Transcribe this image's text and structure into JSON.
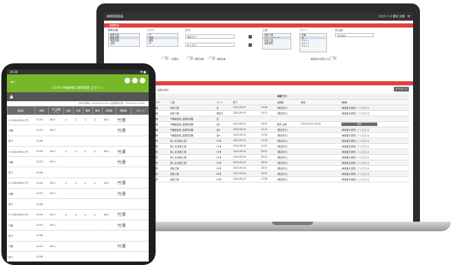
{
  "laptop": {
    "app_title": "帳票管理画面",
    "user_info": "(ログイン) 帯谷 太郎",
    "menu_label": "≡",
    "search_bar": "実績検索",
    "filters": {
      "factory_label": "帳票分類：",
      "factory_options": [
        "帳票分類",
        "製造日報",
        "検査記録",
        "点検"
      ],
      "floor_label": "フロア：",
      "floor_options": [
        "1F",
        "竹輪",
        "揚物",
        "2F"
      ],
      "date_label": "日付：",
      "date_start": "開始日付：",
      "date_end": "終了日付：",
      "process_label": "工程：",
      "process_options": [
        "技術工程",
        "ストックヤード",
        "加熱工程",
        "金属検知"
      ],
      "line_label": "ライン：",
      "line_options": [
        "竹輪",
        "全",
        "1ライン",
        "2ライン",
        "3ライン"
      ],
      "person_label": "担当者：",
      "person_placeholder": "担当者名",
      "toggle1": "一覧表示",
      "toggle2": "異状対策",
      "toggle3": "承認対象",
      "toggle4": "承認済みを表示する"
    },
    "legend": {
      "a": "●コメントあり",
      "b": "●一覧表示",
      "c": "●一覧表示済み"
    },
    "reload": "↻ リロード",
    "table": {
      "group_headers": [
        "記録",
        "承認フロー"
      ],
      "columns": [
        "開始",
        "",
        "フロア",
        "工程",
        "ライン",
        "終了",
        "",
        "記録者",
        "承認",
        "(管理)"
      ],
      "rows": [
        [
          "2024-09-25",
          "10:27",
          "竹輪",
          "技術工程",
          "全",
          "2024-09-25",
          "10:28",
          "(署名待ち)",
          "",
          "(承認者を選択してください)"
        ],
        [
          "2024-09-25",
          "10:21",
          "竹輪",
          "技術工程",
          "測定日",
          "2024-09-25",
          "10:21",
          "(署名待ち)",
          "",
          "(承認者を選択してください)"
        ],
        [
          "2024-09-24",
          "16:55",
          "竹輪",
          "竹輪製品用_金属探知機",
          "全",
          "",
          "",
          "",
          "",
          ""
        ],
        [
          "2024-09-24",
          "16:49",
          "竹輪",
          "竹輪製品用_金属探知機",
          "全A",
          "2024-09-24",
          "16:53",
          "藤本 太郎",
          "2024-09-24 16:54",
          "承認"
        ],
        [
          "2024-09-24",
          "13:13",
          "竹輪",
          "竹輪製品用_金属探知機",
          "全A",
          "2024-09-24",
          "13:14",
          "(署名待ち)",
          "",
          "(承認者を選択してください)"
        ],
        [
          "2024-09-24",
          "11:52",
          "竹輪",
          "竹輪製品用_金属探知機",
          "全A",
          "2024-09-24",
          "11:54",
          "(署名待ち)",
          "",
          "(承認者を選択してください)"
        ],
        [
          "2024-09-24",
          "21:32",
          "揚物",
          "揚し油 技術工程",
          "01号",
          "2024-09-24",
          "21:34",
          "(署名待ち)",
          "",
          "(承認者を選択してください)"
        ],
        [
          "2024-09-24",
          "21:02",
          "揚物",
          "揚し油 技術工程",
          "01号",
          "2024-09-24",
          "21:03",
          "(署名待ち)",
          "",
          "(承認者を選択してください)"
        ],
        [
          "2024-09-24",
          "20:50",
          "揚物",
          "揚し油 技術工程",
          "01号",
          "2024-09-24",
          "20:52",
          "(署名待ち)",
          "",
          "(承認者を選択してください)"
        ],
        [
          "2024-09-24",
          "20:40",
          "揚物",
          "揚し油 技術工程",
          "01号",
          "2024-09-24",
          "20:41",
          "(署名待ち)",
          "",
          "(承認者を選択してください)"
        ],
        [
          "2024-09-24",
          "18:53",
          "揚物",
          "揚し油 技術工程",
          "01号",
          "2024-09-24",
          "18:55",
          "(署名待ち)",
          "",
          "(承認者を選択してください)"
        ],
        [
          "2024-09-24",
          "18:31",
          "揚物",
          "技術工程",
          "01号",
          "2024-09-24",
          "18:33",
          "(署名待ち)",
          "",
          "(承認者を選択してください)"
        ],
        [
          "2024-09-24",
          "18:01",
          "揚物",
          "技術工程",
          "08号",
          "2024-09-24",
          "18:03",
          "(署名待ち)",
          "",
          "(承認者を選択してください)"
        ],
        [
          "2024-09-24",
          "17:55",
          "揚物",
          "技術工程",
          "01号",
          "2024-09-24",
          "17:56",
          "(署名待ち)",
          "",
          "(承認者を選択してください)"
        ]
      ]
    }
  },
  "tablet": {
    "status_time": "10:28",
    "status_right": "▼ ■",
    "title": "[CCP] 竹輪加熱工程管理表 全ライン",
    "warning": "▲",
    "note": "(作成日時間：2024/09/25 10:27  最終更新日時：2024/09/25 10:28)",
    "columns": [
      "製造日",
      "時間",
      "中心温度 (℃)",
      "加熱",
      "冷却",
      "異物",
      "異常",
      "記録者",
      "確認者",
      "コメント"
    ],
    "rows": [
      [
        "※ 23GL89EG (千)",
        "15:34",
        "85.0",
        "◎",
        "◎",
        "◎",
        "◎",
        "38.0",
        "竹澤",
        ""
      ],
      [
        "中断",
        "15:25",
        "85.0",
        "-",
        "-",
        "-",
        "-",
        "-",
        "竹澤",
        ""
      ],
      [
        "終了",
        "15:36",
        "",
        "",
        "",
        "",
        "",
        "",
        "",
        ""
      ],
      [
        "※ 23GL89EG (千)",
        "15:34",
        "85.0",
        "◎",
        "◎",
        "◎",
        "◎",
        "38.0",
        "竹澤",
        ""
      ],
      [
        "中断",
        "15:25",
        "85.0",
        "-",
        "-",
        "-",
        "-",
        "-",
        "竹澤",
        ""
      ],
      [
        "終了",
        "15:36",
        "",
        "",
        "",
        "",
        "",
        "",
        "",
        ""
      ],
      [
        "※ 23GL89EG (千)",
        "15:34",
        "85.0",
        "◎",
        "◎",
        "◎",
        "◎",
        "38.0",
        "竹澤",
        ""
      ],
      [
        "中断",
        "15:25",
        "85.0",
        "-",
        "-",
        "-",
        "-",
        "-",
        "竹澤",
        ""
      ],
      [
        "終了",
        "15:36",
        "",
        "",
        "",
        "",
        "",
        "",
        "",
        ""
      ],
      [
        "※ 23GL89EG (千)",
        "15:34",
        "85.0",
        "◎",
        "◎",
        "◎",
        "◎",
        "38.0",
        "竹澤",
        ""
      ],
      [
        "中断",
        "15:25",
        "85.0",
        "-",
        "-",
        "-",
        "-",
        "-",
        "竹澤",
        ""
      ],
      [
        "終了",
        "15:36",
        "",
        "",
        "",
        "",
        "",
        "",
        "",
        ""
      ],
      [
        "中断",
        "15:25",
        "85.0",
        "-",
        "-",
        "-",
        "-",
        "-",
        "竹澤",
        ""
      ],
      [
        "終了",
        "15:36",
        "",
        "",
        "",
        "",
        "",
        "",
        "",
        ""
      ]
    ]
  },
  "colors": {
    "accent_green": "#76b82a",
    "accent_red": "#e04040",
    "dark": "#333333"
  }
}
